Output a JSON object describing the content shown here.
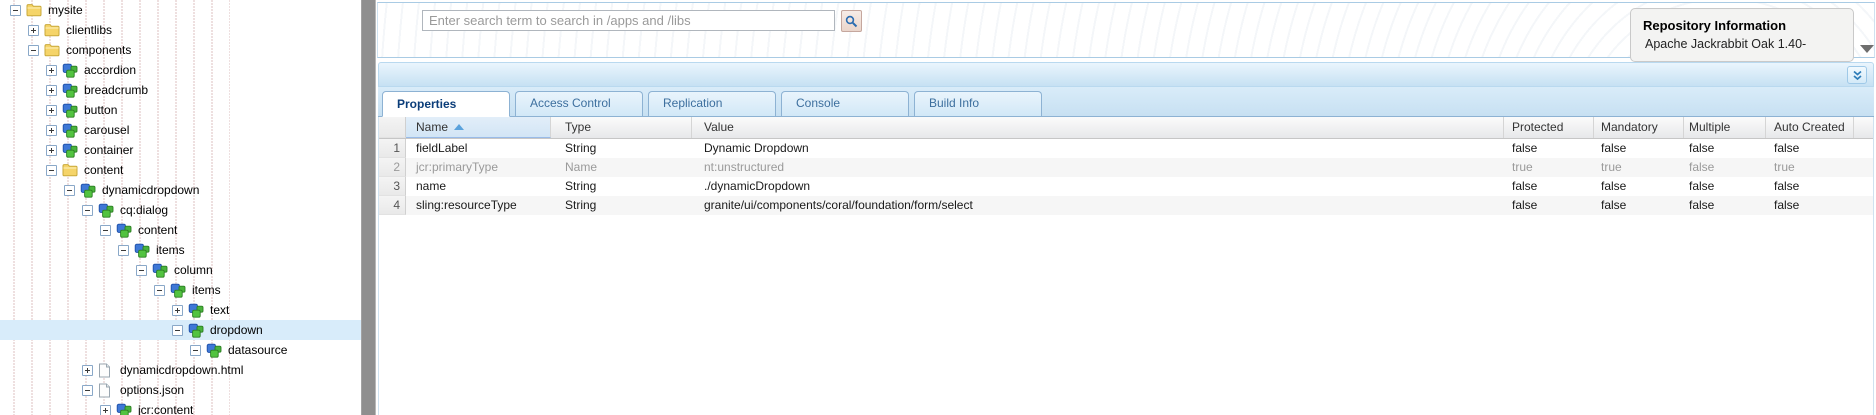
{
  "tree": {
    "nodes": [
      {
        "label": "mysite",
        "depth": 0,
        "icon": "folder-icon",
        "toggle": "minus",
        "selected": false
      },
      {
        "label": "clientlibs",
        "depth": 1,
        "icon": "folder-icon",
        "toggle": "plus",
        "selected": false
      },
      {
        "label": "components",
        "depth": 1,
        "icon": "folder-icon",
        "toggle": "minus",
        "selected": false
      },
      {
        "label": "accordion",
        "depth": 2,
        "icon": "component-icon",
        "toggle": "plus",
        "selected": false
      },
      {
        "label": "breadcrumb",
        "depth": 2,
        "icon": "component-icon",
        "toggle": "plus",
        "selected": false
      },
      {
        "label": "button",
        "depth": 2,
        "icon": "component-icon",
        "toggle": "plus",
        "selected": false
      },
      {
        "label": "carousel",
        "depth": 2,
        "icon": "component-icon",
        "toggle": "plus",
        "selected": false
      },
      {
        "label": "container",
        "depth": 2,
        "icon": "component-icon",
        "toggle": "plus",
        "selected": false
      },
      {
        "label": "content",
        "depth": 2,
        "icon": "folder-icon",
        "toggle": "minus",
        "selected": false
      },
      {
        "label": "dynamicdropdown",
        "depth": 3,
        "icon": "component-icon",
        "toggle": "minus",
        "selected": false
      },
      {
        "label": "cq:dialog",
        "depth": 4,
        "icon": "component-icon",
        "toggle": "minus",
        "selected": false
      },
      {
        "label": "content",
        "depth": 5,
        "icon": "component-icon",
        "toggle": "minus",
        "selected": false
      },
      {
        "label": "items",
        "depth": 6,
        "icon": "component-icon",
        "toggle": "minus",
        "selected": false
      },
      {
        "label": "column",
        "depth": 7,
        "icon": "component-icon",
        "toggle": "minus",
        "selected": false
      },
      {
        "label": "items",
        "depth": 8,
        "icon": "component-icon",
        "toggle": "minus",
        "selected": false
      },
      {
        "label": "text",
        "depth": 9,
        "icon": "component-icon",
        "toggle": "plus",
        "selected": false
      },
      {
        "label": "dropdown",
        "depth": 9,
        "icon": "component-icon",
        "toggle": "minus",
        "selected": true
      },
      {
        "label": "datasource",
        "depth": 10,
        "icon": "component-icon",
        "toggle": "minus",
        "selected": false
      },
      {
        "label": "dynamicdropdown.html",
        "depth": 4,
        "icon": "file-icon",
        "toggle": "plus",
        "selected": false
      },
      {
        "label": "options.json",
        "depth": 4,
        "icon": "file-icon",
        "toggle": "minus",
        "selected": false
      },
      {
        "label": "jcr:content",
        "depth": 5,
        "icon": "component-icon",
        "toggle": "plus",
        "selected": false
      }
    ]
  },
  "toolbar": {
    "search_placeholder": "Enter search term to search in /apps and /libs",
    "search_icon": "magnifier-icon"
  },
  "repo_info": {
    "title": "Repository Information",
    "line1": "Apache Jackrabbit Oak 1.40-"
  },
  "tabs": [
    {
      "label": "Properties",
      "active": true
    },
    {
      "label": "Access Control",
      "active": false
    },
    {
      "label": "Replication",
      "active": false
    },
    {
      "label": "Console",
      "active": false
    },
    {
      "label": "Build Info",
      "active": false
    }
  ],
  "grid": {
    "columns": [
      "Name",
      "Type",
      "Value",
      "Protected",
      "Mandatory",
      "Multiple",
      "Auto Created"
    ],
    "sorted_column": "Name",
    "sort_direction": "ascending",
    "rows": [
      {
        "num": "1",
        "name": "fieldLabel",
        "type": "String",
        "value": "Dynamic Dropdown",
        "protected": "false",
        "mandatory": "false",
        "multiple": "false",
        "auto_created": "false",
        "muted": false
      },
      {
        "num": "2",
        "name": "jcr:primaryType",
        "type": "Name",
        "value": "nt:unstructured",
        "protected": "true",
        "mandatory": "true",
        "multiple": "false",
        "auto_created": "true",
        "muted": true
      },
      {
        "num": "3",
        "name": "name",
        "type": "String",
        "value": "./dynamicDropdown",
        "protected": "false",
        "mandatory": "false",
        "multiple": "false",
        "auto_created": "false",
        "muted": false
      },
      {
        "num": "4",
        "name": "sling:resourceType",
        "type": "String",
        "value": "granite/ui/components/coral/foundation/form/select",
        "protected": "false",
        "mandatory": "false",
        "multiple": "false",
        "auto_created": "false",
        "muted": false
      }
    ]
  },
  "colors": {
    "selection_blue": "#d8ecfa",
    "panel_border_blue": "#a9cbe4",
    "tab_border_blue": "#8db2d3",
    "band_gradient_top": "#eaf5fd",
    "band_gradient_bottom": "#c6e1f3",
    "sorted_header_blue": "#d7e8f6",
    "splitter_gray": "#8f8f8f",
    "muted_text_gray": "#9a9a9a"
  }
}
